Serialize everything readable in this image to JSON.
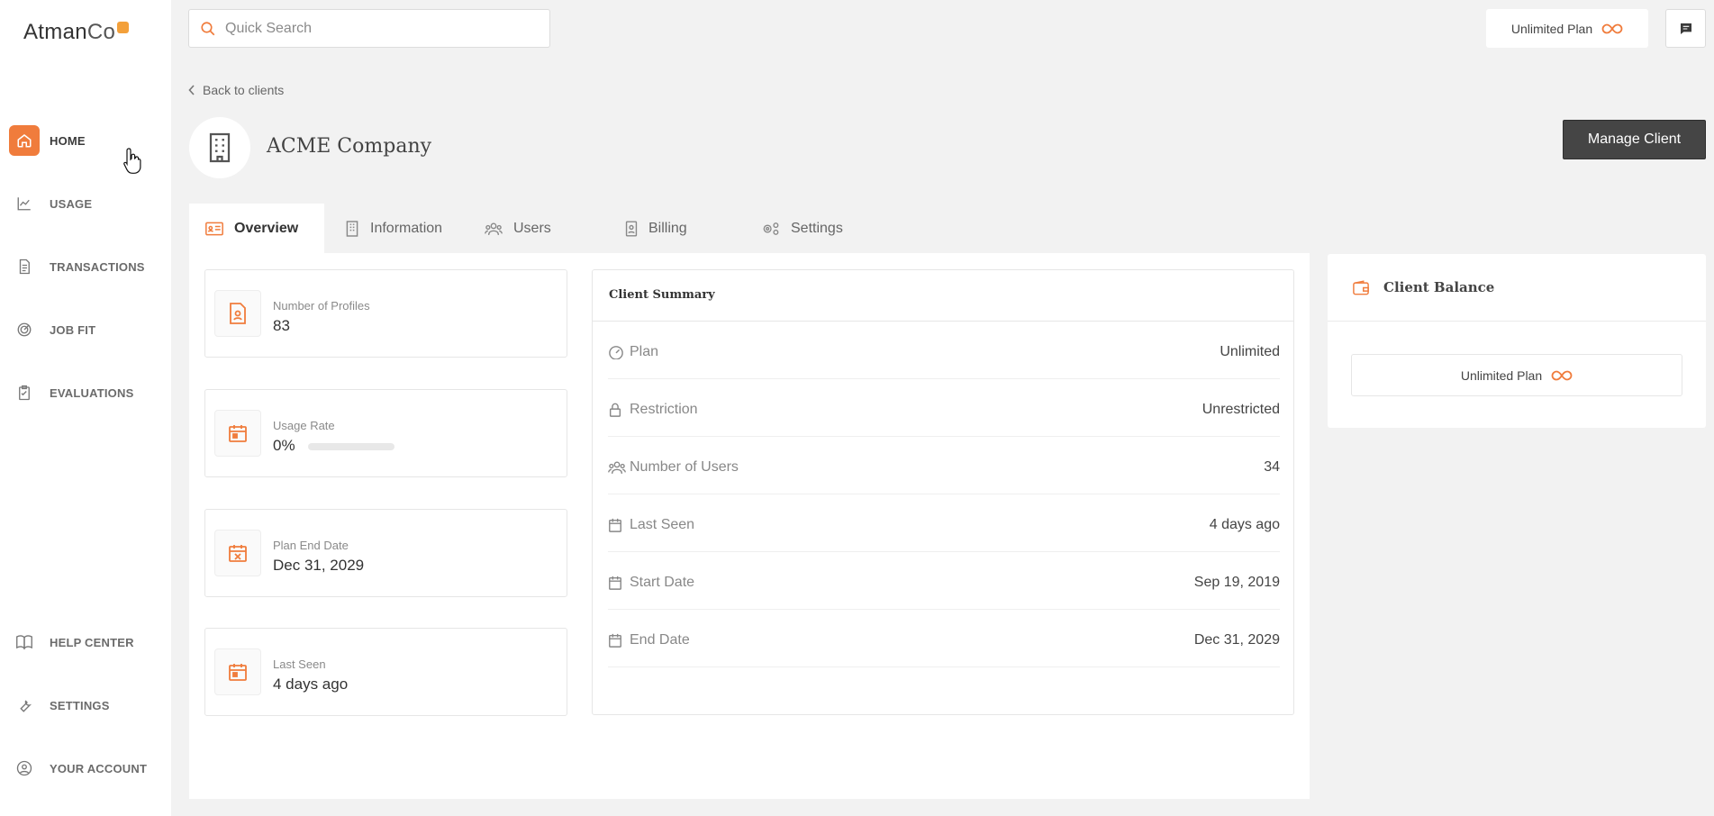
{
  "brand": {
    "logo_main": "Atman",
    "logo_suffix": "Co",
    "accent": "#f07c3c"
  },
  "sidebar": {
    "items": [
      {
        "label": "HOME",
        "icon": "home-icon",
        "active": true
      },
      {
        "label": "USAGE",
        "icon": "trend-icon"
      },
      {
        "label": "TRANSACTIONS",
        "icon": "document-icon"
      },
      {
        "label": "JOB FIT",
        "icon": "target-icon"
      },
      {
        "label": "EVALUATIONS",
        "icon": "clipboard-icon"
      }
    ],
    "bottom_items": [
      {
        "label": "HELP CENTER",
        "icon": "book-icon"
      },
      {
        "label": "SETTINGS",
        "icon": "wrench-icon"
      },
      {
        "label": "YOUR ACCOUNT",
        "icon": "user-circle-icon"
      }
    ]
  },
  "topbar": {
    "search_placeholder": "Quick Search",
    "plan_label": "Unlimited Plan",
    "plan_icon": "infinity-icon",
    "chat_icon": "chat-icon"
  },
  "header": {
    "back_label": "Back to clients",
    "company_name": "ACME Company",
    "manage_label": "Manage Client"
  },
  "tabs": [
    {
      "label": "Overview",
      "icon": "id-card-icon",
      "active": true
    },
    {
      "label": "Information",
      "icon": "building-icon"
    },
    {
      "label": "Users",
      "icon": "users-icon"
    },
    {
      "label": "Billing",
      "icon": "billing-icon"
    },
    {
      "label": "Settings",
      "icon": "gears-icon"
    }
  ],
  "stats": [
    {
      "label": "Number of Profiles",
      "value": "83",
      "icon": "profile-doc-icon"
    },
    {
      "label": "Usage Rate",
      "value": "0%",
      "icon": "calendar-icon",
      "progress": 0
    },
    {
      "label": "Plan End Date",
      "value": "Dec 31, 2029",
      "icon": "calendar-x-icon"
    },
    {
      "label": "Last Seen",
      "value": "4 days ago",
      "icon": "calendar-icon"
    }
  ],
  "summary": {
    "title": "Client Summary",
    "rows": [
      {
        "label": "Plan",
        "value": "Unlimited",
        "icon": "gauge-icon"
      },
      {
        "label": "Restriction",
        "value": "Unrestricted",
        "icon": "lock-icon"
      },
      {
        "label": "Number of Users",
        "value": "34",
        "icon": "users-icon"
      },
      {
        "label": "Last Seen",
        "value": "4 days ago",
        "icon": "calendar-icon"
      },
      {
        "label": "Start Date",
        "value": "Sep 19, 2019",
        "icon": "calendar-icon"
      },
      {
        "label": "End Date",
        "value": "Dec 31, 2029",
        "icon": "calendar-icon"
      }
    ]
  },
  "balance": {
    "title": "Client Balance",
    "icon": "wallet-icon",
    "plan_label": "Unlimited Plan",
    "plan_icon": "infinity-icon"
  }
}
